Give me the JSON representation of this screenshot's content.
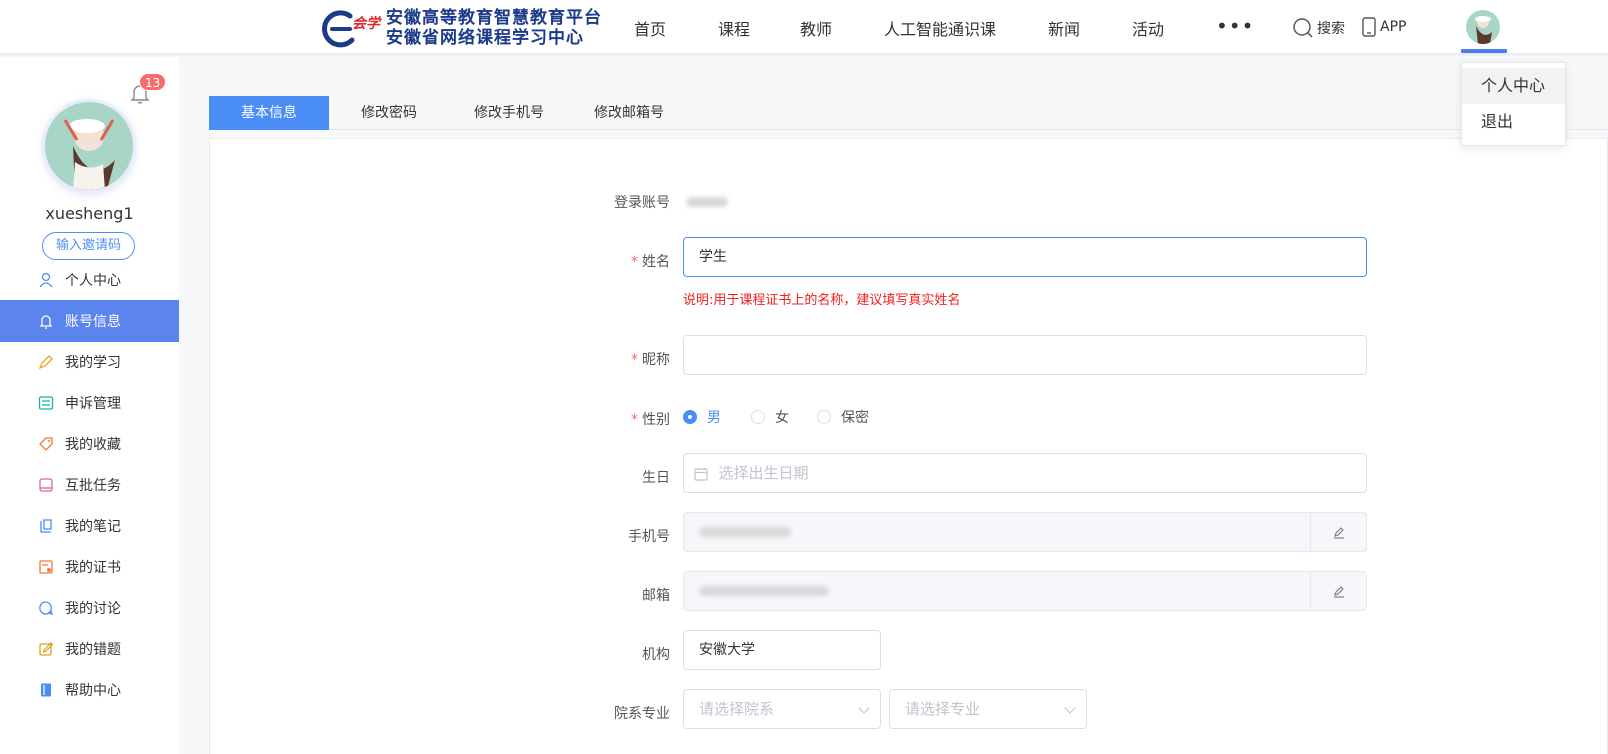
{
  "header": {
    "logo_mark_text": "e会学",
    "logo_line1": "安徽高等教育智慧教育平台",
    "logo_line2": "安徽省网络课程学习中心",
    "nav": [
      "首页",
      "课程",
      "教师",
      "人工智能通识课",
      "新闻",
      "活动"
    ],
    "more": "•••",
    "search_label": "搜索",
    "app_label": "APP"
  },
  "dropdown": {
    "items": [
      "个人中心",
      "退出"
    ]
  },
  "sidebar": {
    "notification_count": "13",
    "username": "xuesheng1",
    "invite_button": "输入邀请码",
    "menu": [
      {
        "label": "个人中心",
        "icon": "user-icon"
      },
      {
        "label": "账号信息",
        "icon": "bell-icon"
      },
      {
        "label": "我的学习",
        "icon": "pencil-icon"
      },
      {
        "label": "申诉管理",
        "icon": "list-icon"
      },
      {
        "label": "我的收藏",
        "icon": "tag-icon"
      },
      {
        "label": "互批任务",
        "icon": "book-icon"
      },
      {
        "label": "我的笔记",
        "icon": "note-icon"
      },
      {
        "label": "我的证书",
        "icon": "certificate-icon"
      },
      {
        "label": "我的讨论",
        "icon": "chat-icon"
      },
      {
        "label": "我的错题",
        "icon": "edit-icon"
      },
      {
        "label": "帮助中心",
        "icon": "help-book-icon"
      }
    ],
    "active_index": 1
  },
  "tabs": [
    "基本信息",
    "修改密码",
    "修改手机号",
    "修改邮箱号"
  ],
  "form": {
    "account_label": "登录账号",
    "name_label": "姓名",
    "name_value": "学生",
    "name_hint": "说明:用于课程证书上的名称，建议填写真实姓名",
    "nickname_label": "昵称",
    "nickname_value": "",
    "gender_label": "性别",
    "gender_options": [
      "男",
      "女",
      "保密"
    ],
    "gender_selected": "男",
    "birthday_label": "生日",
    "birthday_placeholder": "选择出生日期",
    "phone_label": "手机号",
    "email_label": "邮箱",
    "org_label": "机构",
    "org_value": "安徽大学",
    "dept_label": "院系专业",
    "dept_placeholder": "请选择院系",
    "major_placeholder": "请选择专业"
  },
  "colors": {
    "primary": "#4a8ef5",
    "sidebar_active": "#5b84ee",
    "required": "#f56c6c",
    "hint": "#f02020",
    "badge": "#f56c6c"
  }
}
